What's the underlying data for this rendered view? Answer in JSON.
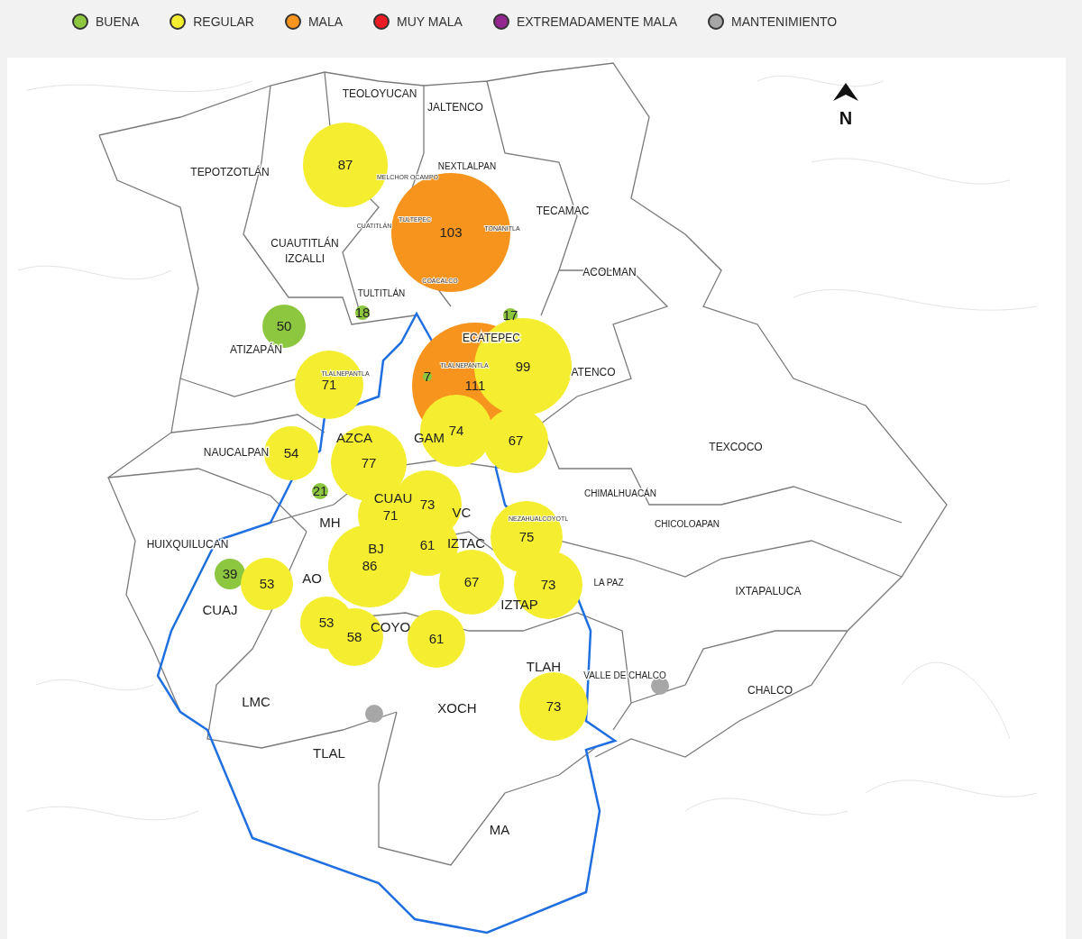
{
  "legend": [
    {
      "label": "BUENA",
      "color": "#8dc63f"
    },
    {
      "label": "REGULAR",
      "color": "#f5ee30"
    },
    {
      "label": "MALA",
      "color": "#f7941d"
    },
    {
      "label": "MUY MALA",
      "color": "#ed1c24"
    },
    {
      "label": "EXTREMADAMENTE MALA",
      "color": "#92278f"
    },
    {
      "label": "MANTENIMIENTO",
      "color": "#a7a7a7"
    }
  ],
  "map": {
    "north_label": "N",
    "places": [
      {
        "name": "TEOLOYUCAN",
        "kind": "large"
      },
      {
        "name": "JALTENCO",
        "kind": "large"
      },
      {
        "name": "TEPOTZOTLÁN",
        "kind": "large"
      },
      {
        "name": "NEXTLALPAN",
        "kind": "small"
      },
      {
        "name": "MELCHOR OCAMPO",
        "kind": "tiny"
      },
      {
        "name": "TECAMAC",
        "kind": "large"
      },
      {
        "name": "CUATITLÁN",
        "kind": "tiny"
      },
      {
        "name": "TULTEPEC",
        "kind": "tiny"
      },
      {
        "name": "TONANITLA",
        "kind": "tiny"
      },
      {
        "name": "CUAUTITLÁN IZCALLI",
        "kind": "large"
      },
      {
        "name": "COACALCO",
        "kind": "tiny"
      },
      {
        "name": "ACOLMAN",
        "kind": "large"
      },
      {
        "name": "TULTITLÁN",
        "kind": "small"
      },
      {
        "name": "ATIZAPÁN",
        "kind": "large"
      },
      {
        "name": "ECATEPEC",
        "kind": "large"
      },
      {
        "name": "TLALNEPANTLA",
        "kind": "tiny"
      },
      {
        "name": "TLALNEPANTLA",
        "kind": "tiny"
      },
      {
        "name": "ATENCO",
        "kind": "large"
      },
      {
        "name": "NAUCALPAN",
        "kind": "large"
      },
      {
        "name": "AZCA",
        "kind": "city"
      },
      {
        "name": "GAM",
        "kind": "city"
      },
      {
        "name": "TEXCOCO",
        "kind": "large"
      },
      {
        "name": "CUAU",
        "kind": "city"
      },
      {
        "name": "VC",
        "kind": "city"
      },
      {
        "name": "MH",
        "kind": "city"
      },
      {
        "name": "CHIMALHUACÁN",
        "kind": "small"
      },
      {
        "name": "NEZAHUALCOYOTL",
        "kind": "tiny"
      },
      {
        "name": "CHICOLOAPAN",
        "kind": "small"
      },
      {
        "name": "HUIXQUILUCAN",
        "kind": "large"
      },
      {
        "name": "IZTAC",
        "kind": "city"
      },
      {
        "name": "BJ",
        "kind": "city"
      },
      {
        "name": "AO",
        "kind": "city"
      },
      {
        "name": "LA PAZ",
        "kind": "small"
      },
      {
        "name": "IXTAPALUCA",
        "kind": "large"
      },
      {
        "name": "CUAJ",
        "kind": "city"
      },
      {
        "name": "IZTAP",
        "kind": "city"
      },
      {
        "name": "COYO",
        "kind": "city"
      },
      {
        "name": "TLAH",
        "kind": "city"
      },
      {
        "name": "VALLE DE CHALCO",
        "kind": "small"
      },
      {
        "name": "CHALCO",
        "kind": "large"
      },
      {
        "name": "LMC",
        "kind": "city"
      },
      {
        "name": "XOCH",
        "kind": "city"
      },
      {
        "name": "TLAL",
        "kind": "city"
      },
      {
        "name": "MA",
        "kind": "city"
      }
    ],
    "stations": [
      {
        "reading": "103",
        "color": "#f7941d"
      },
      {
        "reading": "111",
        "color": "#f7941d"
      },
      {
        "reading": "87",
        "color": "#f5ee30"
      },
      {
        "reading": "18",
        "color": "#8dc63f"
      },
      {
        "reading": "17",
        "color": "#8dc63f"
      },
      {
        "reading": "50",
        "color": "#8dc63f"
      },
      {
        "reading": "99",
        "color": "#f5ee30"
      },
      {
        "reading": "71",
        "color": "#f5ee30"
      },
      {
        "reading": "74",
        "color": "#f5ee30"
      },
      {
        "reading": "67",
        "color": "#f5ee30"
      },
      {
        "reading": "7",
        "color": "#8dc63f"
      },
      {
        "reading": "54",
        "color": "#f5ee30"
      },
      {
        "reading": "77",
        "color": "#f5ee30"
      },
      {
        "reading": "21",
        "color": "#8dc63f"
      },
      {
        "reading": "73",
        "color": "#f5ee30"
      },
      {
        "reading": "71",
        "color": "#f5ee30"
      },
      {
        "reading": "75",
        "color": "#f5ee30"
      },
      {
        "reading": "61",
        "color": "#f5ee30"
      },
      {
        "reading": "86",
        "color": "#f5ee30"
      },
      {
        "reading": "39",
        "color": "#8dc63f"
      },
      {
        "reading": "53",
        "color": "#f5ee30"
      },
      {
        "reading": "67",
        "color": "#f5ee30"
      },
      {
        "reading": "73",
        "color": "#f5ee30"
      },
      {
        "reading": "53",
        "color": "#f5ee30"
      },
      {
        "reading": "58",
        "color": "#f5ee30"
      },
      {
        "reading": "61",
        "color": "#f5ee30"
      },
      {
        "reading": "73",
        "color": "#f5ee30"
      },
      {
        "color": "#a7a7a7"
      },
      {
        "color": "#a7a7a7"
      }
    ]
  }
}
